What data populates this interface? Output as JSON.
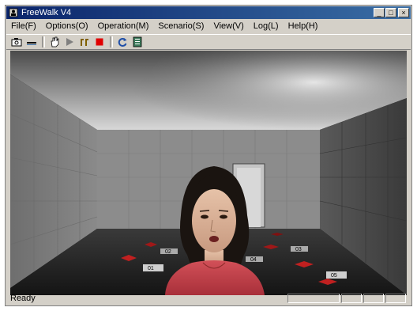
{
  "window": {
    "title": "FreeWalk V4"
  },
  "titlebar_buttons": {
    "minimize": "_",
    "maximize": "□",
    "close": "×"
  },
  "menu": [
    {
      "label": "File(F)"
    },
    {
      "label": "Options(O)"
    },
    {
      "label": "Operation(M)"
    },
    {
      "label": "Scenario(S)"
    },
    {
      "label": "View(V)"
    },
    {
      "label": "Log(L)"
    },
    {
      "label": "Help(H)"
    }
  ],
  "toolbar": {
    "icons": [
      "camera-icon",
      "minus-icon",
      "hand-icon",
      "play-icon",
      "fast-forward-icon",
      "stop-icon",
      "refresh-icon",
      "document-icon"
    ],
    "colors": {
      "stop": "#e00000",
      "refresh": "#1f4fa8",
      "document": "#3a7a5a",
      "play": "#808080",
      "ff": "#806000"
    }
  },
  "scene": {
    "floor_labels": [
      "01",
      "02",
      "03",
      "04",
      "05"
    ],
    "description_colors": {
      "shirt": "#c4404a",
      "wall": "#8a8a8a",
      "floor": "#2a2a2a"
    }
  },
  "status": {
    "text": "Ready"
  }
}
